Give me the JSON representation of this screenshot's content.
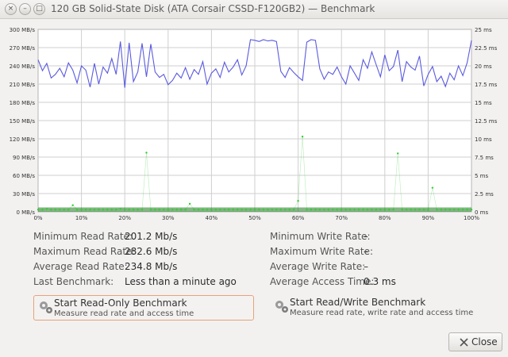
{
  "window": {
    "title": "120 GB Solid-State Disk (ATA Corsair CSSD-F120GB2) — Benchmark",
    "controls": {
      "close": "×",
      "minimize": "–",
      "maximize": "□"
    }
  },
  "chart_data": {
    "type": "line",
    "x_ticks": [
      "0%",
      "10%",
      "20%",
      "30%",
      "40%",
      "50%",
      "60%",
      "70%",
      "80%",
      "90%",
      "100%"
    ],
    "y_left_ticks": [
      "0 MB/s",
      "30 MB/s",
      "60 MB/s",
      "90 MB/s",
      "120 MB/s",
      "150 MB/s",
      "180 MB/s",
      "210 MB/s",
      "240 MB/s",
      "270 MB/s",
      "300 MB/s"
    ],
    "y_right_ticks": [
      "0 ms",
      "2.5 ms",
      "5 ms",
      "7.5 ms",
      "10 ms",
      "12.5 ms",
      "15 ms",
      "17.5 ms",
      "20 ms",
      "22.5 ms",
      "25 ms"
    ],
    "x_range": [
      0,
      100
    ],
    "y_left_range": [
      0,
      300
    ],
    "y_right_range": [
      0,
      25
    ],
    "grid": true,
    "colors": {
      "read": "#5a5ae0",
      "access": "#33cc33",
      "grid": "#cfcfcf"
    },
    "read_rate": {
      "x": [
        0,
        1,
        2,
        3,
        4,
        5,
        6,
        7,
        8,
        9,
        10,
        11,
        12,
        13,
        14,
        15,
        16,
        17,
        18,
        19,
        20,
        21,
        22,
        23,
        24,
        25,
        26,
        27,
        28,
        29,
        30,
        31,
        32,
        33,
        34,
        35,
        36,
        37,
        38,
        39,
        40,
        41,
        42,
        43,
        44,
        45,
        46,
        47,
        48,
        49,
        50,
        51,
        52,
        53,
        54,
        55,
        56,
        57,
        58,
        59,
        60,
        61,
        62,
        63,
        64,
        65,
        66,
        67,
        68,
        69,
        70,
        71,
        72,
        73,
        74,
        75,
        76,
        77,
        78,
        79,
        80,
        81,
        82,
        83,
        84,
        85,
        86,
        87,
        88,
        89,
        90,
        91,
        92,
        93,
        94,
        95,
        96,
        97,
        98,
        99,
        100
      ],
      "y": [
        250,
        232,
        244,
        220,
        226,
        236,
        222,
        245,
        233,
        212,
        240,
        233,
        205,
        244,
        210,
        238,
        228,
        252,
        226,
        280,
        204,
        278,
        214,
        230,
        277,
        222,
        276,
        230,
        221,
        226,
        209,
        216,
        228,
        220,
        237,
        218,
        234,
        226,
        247,
        210,
        228,
        235,
        221,
        246,
        230,
        238,
        250,
        225,
        240,
        283,
        282,
        280,
        283,
        281,
        282,
        280,
        231,
        221,
        237,
        229,
        222,
        216,
        279,
        283,
        282,
        235,
        218,
        230,
        226,
        238,
        222,
        210,
        240,
        228,
        216,
        250,
        236,
        263,
        242,
        222,
        258,
        232,
        239,
        266,
        214,
        247,
        238,
        233,
        256,
        207,
        226,
        239,
        214,
        223,
        206,
        228,
        217,
        240,
        224,
        245,
        282
      ]
    },
    "access_time": {
      "x": [
        0,
        1,
        2,
        3,
        4,
        5,
        6,
        7,
        8,
        9,
        10,
        11,
        12,
        13,
        14,
        15,
        16,
        17,
        18,
        19,
        20,
        21,
        22,
        23,
        24,
        25,
        26,
        27,
        28,
        29,
        30,
        31,
        32,
        33,
        34,
        35,
        36,
        37,
        38,
        39,
        40,
        41,
        42,
        43,
        44,
        45,
        46,
        47,
        48,
        49,
        50,
        51,
        52,
        53,
        54,
        55,
        56,
        57,
        58,
        59,
        60,
        61,
        62,
        63,
        64,
        65,
        66,
        67,
        68,
        69,
        70,
        71,
        72,
        73,
        74,
        75,
        76,
        77,
        78,
        79,
        80,
        81,
        82,
        83,
        84,
        85,
        86,
        87,
        88,
        89,
        90,
        91,
        92,
        93,
        94,
        95,
        96,
        97,
        98,
        99,
        100
      ],
      "y": [
        0.3,
        0.3,
        0.4,
        0.3,
        0.3,
        0.3,
        0.3,
        0.3,
        0.9,
        0.3,
        0.3,
        0.3,
        0.3,
        0.3,
        0.3,
        0.3,
        0.3,
        0.3,
        0.3,
        0.4,
        0.3,
        0.3,
        0.3,
        0.3,
        0.3,
        8.1,
        0.3,
        0.3,
        0.3,
        0.3,
        0.3,
        0.3,
        0.3,
        0.3,
        0.3,
        1.1,
        0.3,
        0.3,
        0.3,
        0.3,
        0.3,
        0.3,
        0.3,
        0.3,
        0.3,
        0.3,
        0.3,
        0.3,
        0.3,
        0.3,
        0.3,
        0.3,
        0.3,
        0.3,
        0.3,
        0.3,
        0.3,
        0.3,
        0.3,
        0.3,
        1.5,
        10.3,
        0.3,
        0.3,
        0.3,
        0.3,
        0.3,
        0.3,
        0.3,
        0.3,
        0.3,
        0.3,
        0.3,
        0.3,
        0.3,
        0.3,
        0.3,
        0.3,
        0.3,
        0.3,
        0.3,
        0.3,
        0.3,
        8.0,
        0.3,
        0.3,
        0.3,
        0.3,
        0.3,
        0.3,
        0.3,
        3.3,
        0.3,
        0.3,
        0.3,
        0.3,
        0.3,
        0.3,
        0.3,
        0.3,
        0.3
      ]
    }
  },
  "stats": {
    "min_read": {
      "label": "Minimum Read Rate:",
      "value": "201.2 Mb/s"
    },
    "max_read": {
      "label": "Maximum Read Rate:",
      "value": "282.6 Mb/s"
    },
    "avg_read": {
      "label": "Average Read Rate:",
      "value": "234.8 Mb/s"
    },
    "last_bench": {
      "label": "Last Benchmark:",
      "value": "Less than a minute ago"
    },
    "min_write": {
      "label": "Minimum Write Rate:",
      "value": "–"
    },
    "max_write": {
      "label": "Maximum Write Rate:",
      "value": "–"
    },
    "avg_write": {
      "label": "Average Write Rate:",
      "value": "–"
    },
    "avg_access": {
      "label": "Average Access Time:",
      "value": "0.3 ms"
    }
  },
  "buttons": {
    "read_only": {
      "title": "Start Read-Only Benchmark",
      "subtitle": "Measure read rate and access time",
      "icon": "gears-icon"
    },
    "read_write": {
      "title": "Start Read/Write Benchmark",
      "subtitle": "Measure read rate, write rate and access time",
      "icon": "gears-icon"
    },
    "close": {
      "label": "Close",
      "icon": "close-icon"
    }
  }
}
